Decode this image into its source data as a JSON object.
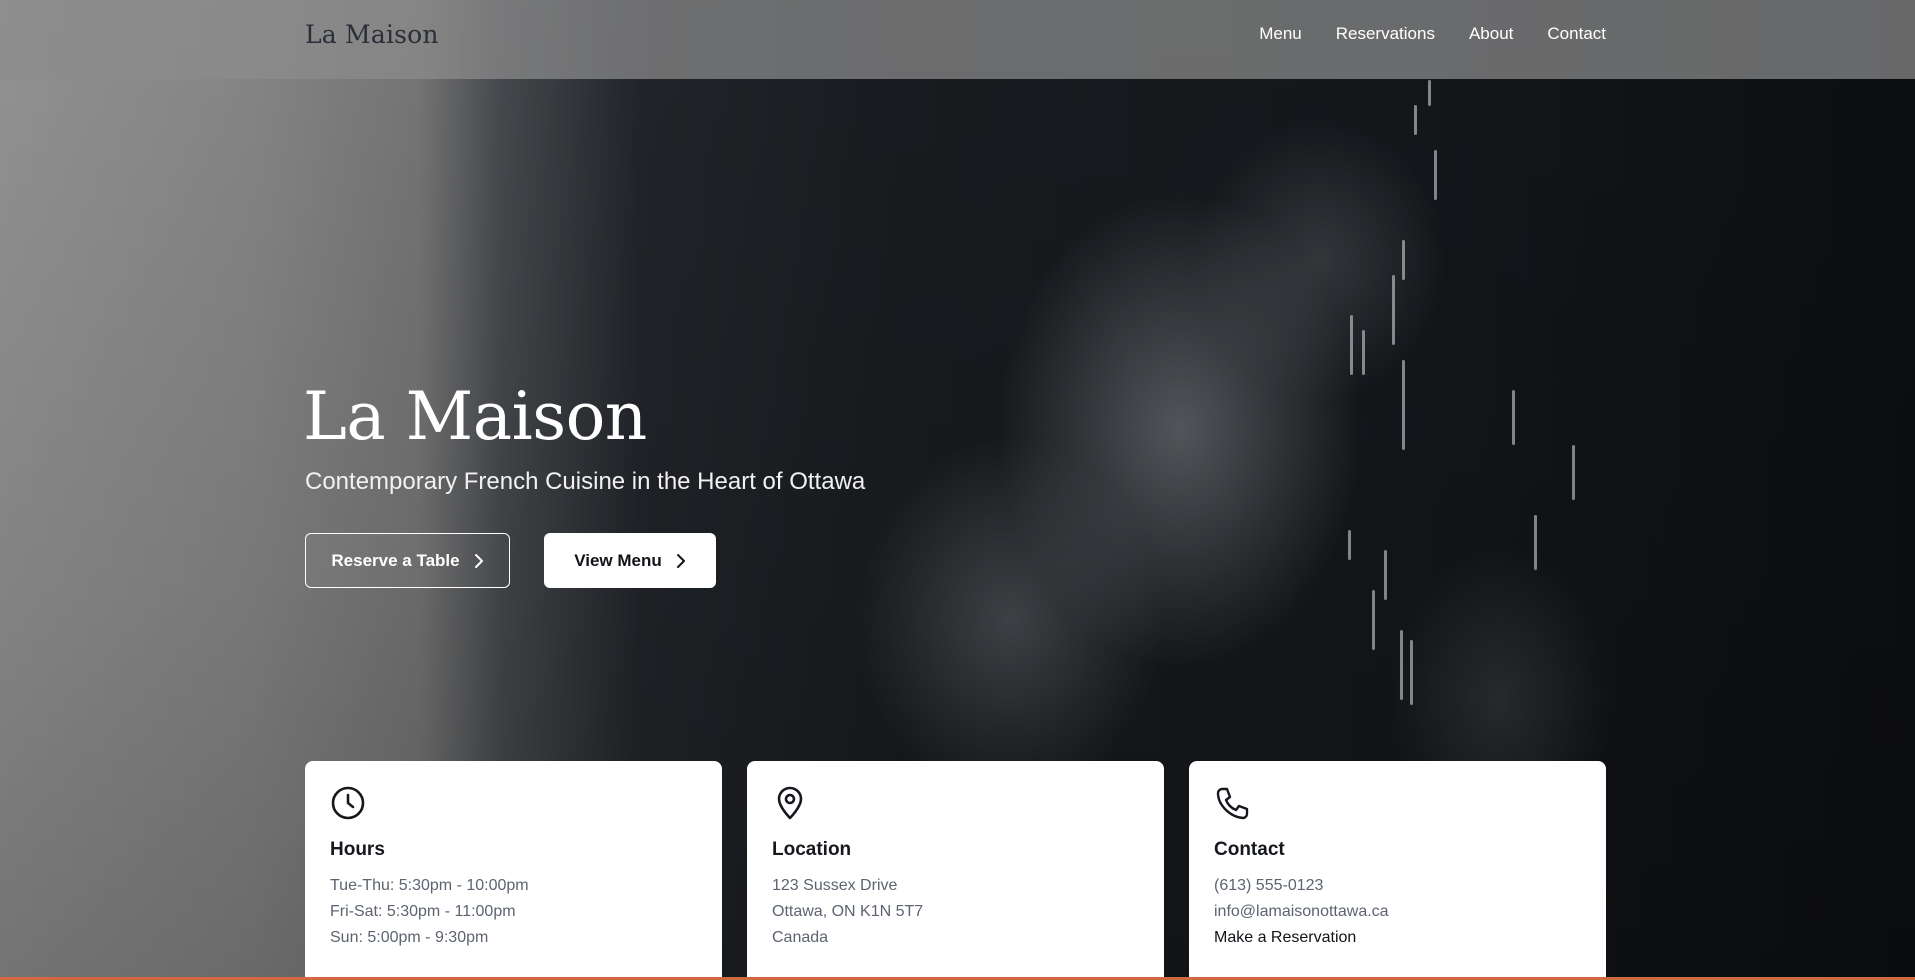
{
  "nav": {
    "brand": "La Maison",
    "links": [
      "Menu",
      "Reservations",
      "About",
      "Contact"
    ]
  },
  "hero": {
    "title": "La Maison",
    "subtitle": "Contemporary French Cuisine in the Heart of Ottawa",
    "primary_button": "Reserve a Table",
    "secondary_button": "View Menu"
  },
  "cards": {
    "hours": {
      "icon": "clock-icon",
      "title": "Hours",
      "lines": [
        "Tue-Thu: 5:30pm - 10:00pm",
        "Fri-Sat: 5:30pm - 11:00pm",
        "Sun: 5:00pm - 9:30pm"
      ]
    },
    "location": {
      "icon": "map-pin-icon",
      "title": "Location",
      "lines": [
        "123 Sussex Drive",
        "Ottawa, ON K1N 5T7",
        "Canada"
      ]
    },
    "contact": {
      "icon": "phone-icon",
      "title": "Contact",
      "lines": [
        "(613) 555-0123",
        "info@lamaisonottawa.ca"
      ],
      "link": "Make a Reservation"
    }
  },
  "colors": {
    "nav_background": "#8c8c8c",
    "brand_text": "#2a2e36",
    "card_background": "#ffffff",
    "card_muted_text": "#5d6470",
    "bottom_accent": "#d0693f"
  }
}
